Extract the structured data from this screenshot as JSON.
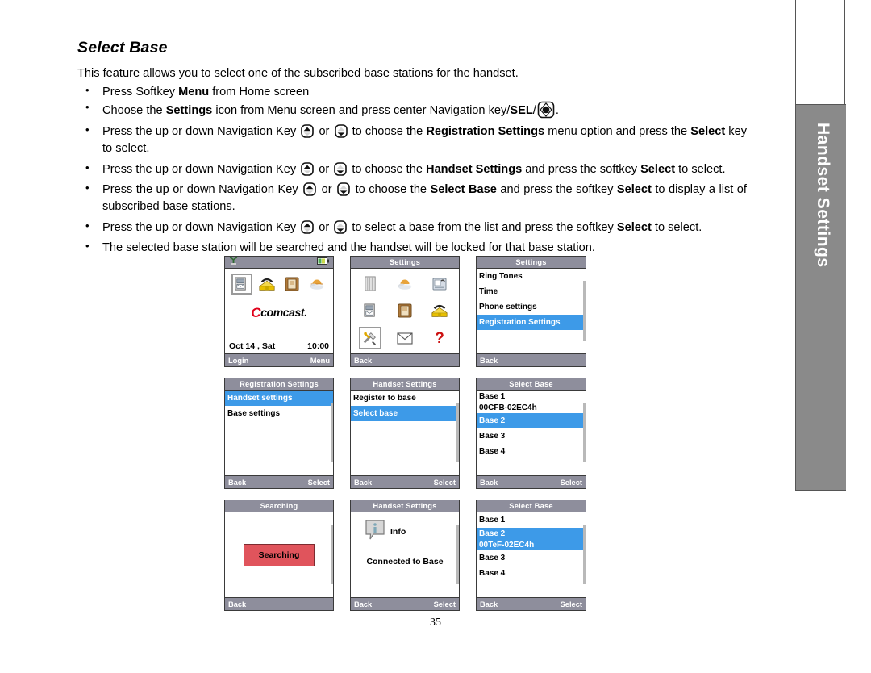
{
  "side_tab": {
    "label": "Handset Settings"
  },
  "page_number": "35",
  "document": {
    "title": "Select Base",
    "intro": "This feature allows you to select one of the subscribed base stations for the handset.",
    "bullets": [
      {
        "parts": [
          {
            "t": "Press Softkey ",
            "b": false
          },
          {
            "t": "Menu",
            "b": true
          },
          {
            "t": " from Home screen",
            "b": false
          }
        ]
      },
      {
        "parts": [
          {
            "t": "Choose the ",
            "b": false
          },
          {
            "t": "Settings",
            "b": true
          },
          {
            "t": " icon from Menu screen and press center Navigation key/",
            "b": false
          },
          {
            "t": "SEL",
            "b": true
          },
          {
            "t": "/",
            "b": false
          },
          {
            "icon": "sel-key-icon"
          },
          {
            "t": ".",
            "b": false
          }
        ]
      },
      {
        "parts": [
          {
            "t": "Press the up or down Navigation Key ",
            "b": false
          },
          {
            "icon": "nav-key-up-icon"
          },
          {
            "t": " or ",
            "b": false
          },
          {
            "icon": "nav-key-down-icon"
          },
          {
            "t": " to choose the ",
            "b": false
          },
          {
            "t": "Registration Settings",
            "b": true
          },
          {
            "t": " menu option and press the ",
            "b": false
          },
          {
            "t": "Select",
            "b": true
          },
          {
            "t": " key to select.",
            "b": false
          }
        ]
      },
      {
        "parts": [
          {
            "t": "Press the up or down Navigation Key ",
            "b": false
          },
          {
            "icon": "nav-key-up-icon"
          },
          {
            "t": " or ",
            "b": false
          },
          {
            "icon": "nav-key-down-icon"
          },
          {
            "t": " to choose the ",
            "b": false
          },
          {
            "t": "Handset Settings",
            "b": true
          },
          {
            "t": " and press the softkey ",
            "b": false
          },
          {
            "t": "Select",
            "b": true
          },
          {
            "t": " to select.",
            "b": false
          }
        ]
      },
      {
        "parts": [
          {
            "t": "Press the up or down Navigation Key ",
            "b": false
          },
          {
            "icon": "nav-key-up-icon"
          },
          {
            "t": " or ",
            "b": false
          },
          {
            "icon": "nav-key-down-icon"
          },
          {
            "t": "  to choose the ",
            "b": false
          },
          {
            "t": "Select Base",
            "b": true
          },
          {
            "t": " and press the softkey ",
            "b": false
          },
          {
            "t": "Select",
            "b": true
          },
          {
            "t": " to display a list of subscribed base stations.",
            "b": false
          }
        ]
      },
      {
        "parts": [
          {
            "t": "Press the up or down Navigation Key ",
            "b": false
          },
          {
            "icon": "nav-key-up-icon"
          },
          {
            "t": " or ",
            "b": false
          },
          {
            "icon": "nav-key-down-icon"
          },
          {
            "t": " to select a base from the list and press the softkey ",
            "b": false
          },
          {
            "t": "Select",
            "b": true
          },
          {
            "t": " to select.",
            "b": false
          }
        ]
      },
      {
        "parts": [
          {
            "t": "The selected base station will be searched and the handset will be locked for that base station.",
            "b": false
          }
        ]
      }
    ]
  },
  "colors": {
    "titlebar": "#8e8e9c",
    "highlight": "#3d9ae8",
    "searching_red": "#e0545c",
    "comcast_red": "#e0001a",
    "side_tab_gray": "#8a8a8a"
  },
  "screens": {
    "home": {
      "icons": [
        "voicemail-icon",
        "phonebook-icon",
        "contacts-icon",
        "weather-icon"
      ],
      "brand": "comcast",
      "brand_mark": "C",
      "date": "Oct 14 , Sat",
      "time": "10:00",
      "softkey_left": "Login",
      "softkey_right": "Menu"
    },
    "settings_icons": {
      "title": "Settings",
      "icons": [
        "notepad-icon",
        "weather-icon",
        "callerid-icon",
        "voicemail-icon",
        "contacts-icon",
        "phonebook-icon",
        "tools-icon",
        "message-icon",
        "help-icon"
      ],
      "softkey_left": "Back",
      "softkey_right": ""
    },
    "settings_list": {
      "title": "Settings",
      "items": [
        {
          "label": "Ring Tones",
          "selected": false
        },
        {
          "label": "Time",
          "selected": false
        },
        {
          "label": "Phone settings",
          "selected": false
        },
        {
          "label": "Registration Settings",
          "selected": true
        }
      ],
      "softkey_left": "Back",
      "softkey_right": ""
    },
    "registration_settings": {
      "title": "Registration Settings",
      "items": [
        {
          "label": "Handset settings",
          "selected": true
        },
        {
          "label": "Base settings",
          "selected": false
        }
      ],
      "softkey_left": "Back",
      "softkey_right": "Select"
    },
    "handset_settings": {
      "title": "Handset Settings",
      "items": [
        {
          "label": "Register to base",
          "selected": false
        },
        {
          "label": "Select base",
          "selected": true
        }
      ],
      "softkey_left": "Back",
      "softkey_right": "Select"
    },
    "select_base_1": {
      "title": "Select Base",
      "items": [
        {
          "label": "Base 1",
          "sub": "00CFB-02EC4h",
          "selected": false
        },
        {
          "label": "Base 2",
          "sub": "",
          "selected": true
        },
        {
          "label": "Base 3",
          "sub": "",
          "selected": false
        },
        {
          "label": "Base 4",
          "sub": "",
          "selected": false
        }
      ],
      "softkey_left": "Back",
      "softkey_right": "Select"
    },
    "searching": {
      "title": "Searching",
      "message": "Searching",
      "softkey_left": "Back",
      "softkey_right": ""
    },
    "connected": {
      "title": "Handset Settings",
      "info_label": "Info",
      "message": "Connected to Base",
      "softkey_left": "Back",
      "softkey_right": "Select"
    },
    "select_base_2": {
      "title": "Select Base",
      "items": [
        {
          "label": "Base 1",
          "sub": "",
          "selected": false
        },
        {
          "label": "Base 2",
          "sub": "00TeF-02EC4h",
          "selected": true
        },
        {
          "label": "Base 3",
          "sub": "",
          "selected": false
        },
        {
          "label": "Base 4",
          "sub": "",
          "selected": false
        }
      ],
      "softkey_left": "Back",
      "softkey_right": "Select"
    }
  }
}
